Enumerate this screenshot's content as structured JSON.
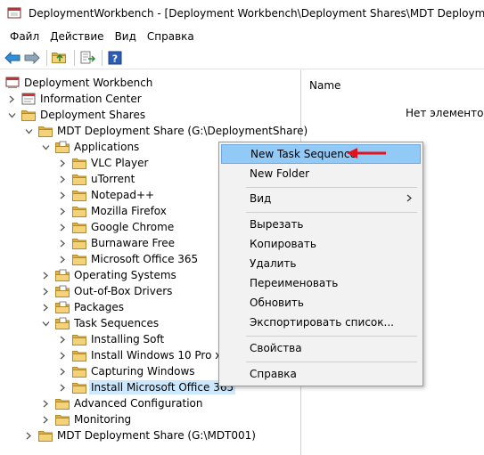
{
  "window": {
    "title": "DeploymentWorkbench - [Deployment Workbench\\Deployment Shares\\MDT Deployment Share (G:\\DeploymentShare\\Applications]"
  },
  "menu": [
    "Файл",
    "Действие",
    "Вид",
    "Справка"
  ],
  "toolbar": {
    "icons": [
      "back-arrow-icon",
      "forward-arrow-icon",
      "up-folder-icon",
      "export-list-icon",
      "help-icon"
    ]
  },
  "tree": {
    "root": "Deployment Workbench",
    "info_center": "Information Center",
    "deployment_shares": "Deployment Shares",
    "share1": "MDT Deployment Share (G:\\DeploymentShare)",
    "applications": "Applications",
    "apps": [
      "VLC Player",
      "uTorrent",
      "Notepad++",
      "Mozilla Firefox",
      "Google Chrome",
      "Burnaware Free",
      "Microsoft Office 365"
    ],
    "operating_systems": "Operating Systems",
    "drivers": "Out-of-Box Drivers",
    "packages": "Packages",
    "task_sequences": "Task Sequences",
    "sequences": [
      "Installing Soft",
      "Install Windows 10 Pro x64",
      "Capturing Windows",
      "Install Microsoft Office 365"
    ],
    "advanced_config": "Advanced Configuration",
    "monitoring": "Monitoring",
    "share2": "MDT Deployment Share (G:\\MDT001)"
  },
  "list": {
    "column_name": "Name",
    "empty_text": "Нет элементов д"
  },
  "context_menu": {
    "new_task_sequence": "New Task Sequence",
    "new_folder": "New Folder",
    "view": "Вид",
    "cut": "Вырезать",
    "copy": "Копировать",
    "delete": "Удалить",
    "rename": "Переименовать",
    "refresh": "Обновить",
    "export_list": "Экспортировать список...",
    "properties": "Свойства",
    "help": "Справка"
  },
  "colors": {
    "highlight": "#91c9f7",
    "selected": "#cce8ff",
    "annotation_arrow": "#e0141e",
    "folder": "#e8c157"
  }
}
